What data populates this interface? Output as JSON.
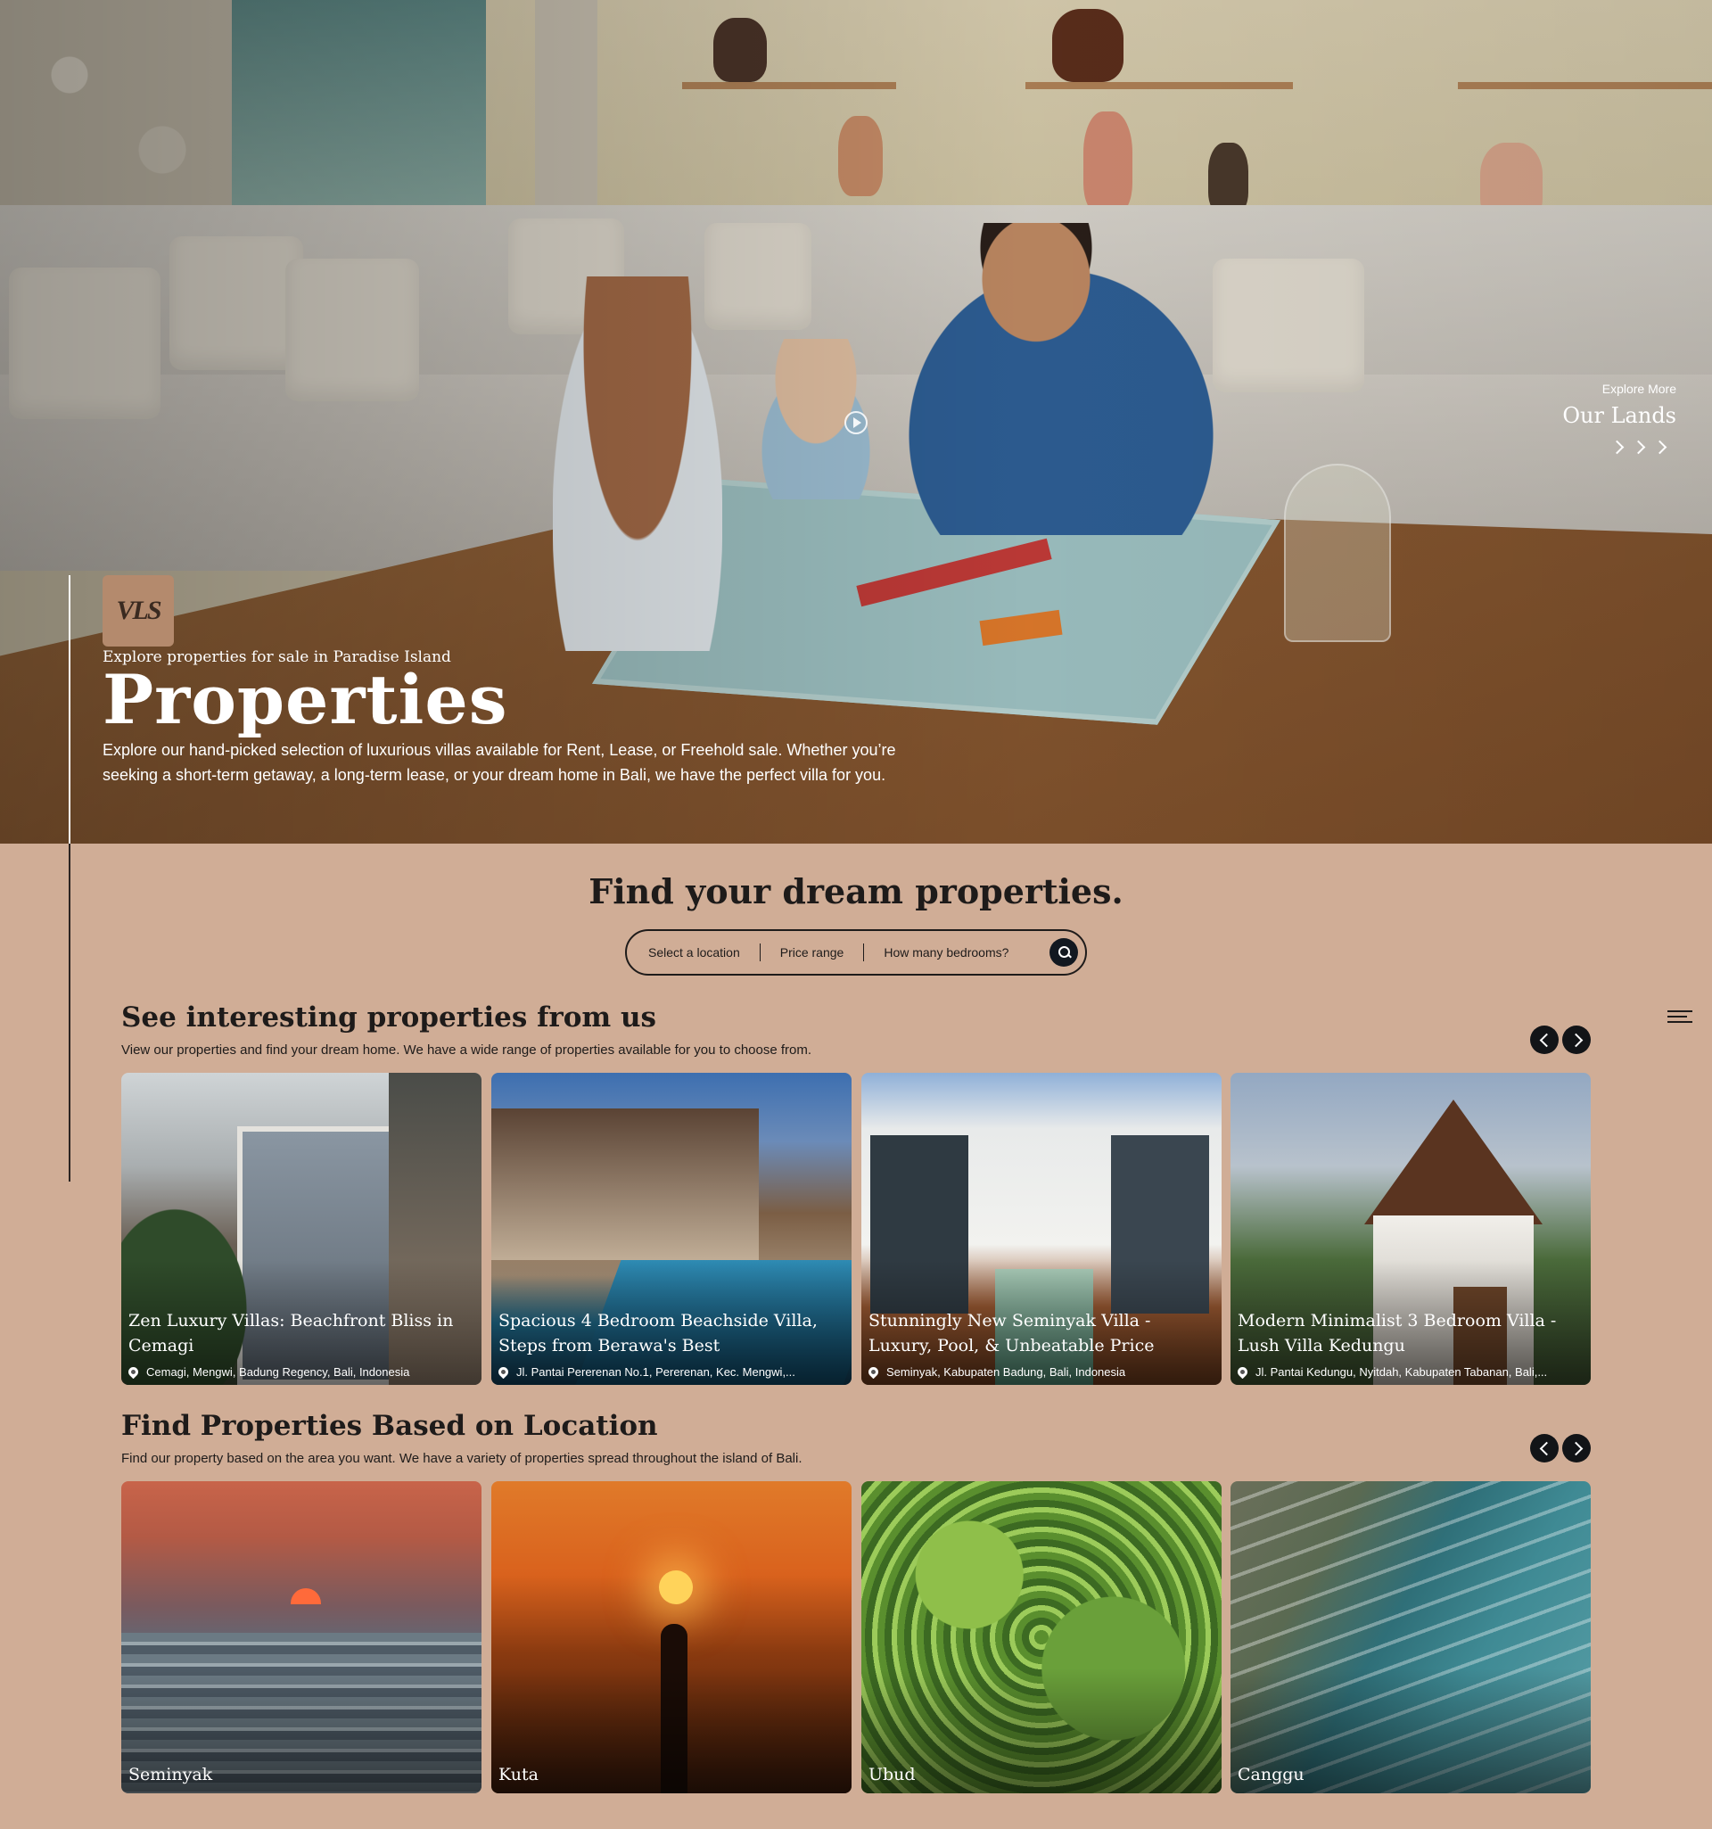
{
  "hero": {
    "logo_text": "VLS",
    "kicker": "Explore properties for sale in Paradise Island",
    "title": "Properties",
    "description": "Explore our hand-picked selection of luxurious villas available for Rent, Lease, or Freehold sale. Whether you’re seeking a short-term getaway, a long-term lease, or your dream home in Bali, we have the perfect villa for you.",
    "explore_small": "Explore More",
    "explore_big": "Our Lands"
  },
  "search": {
    "title": "Find your dream properties.",
    "location_label": "Select a location",
    "price_label": "Price range",
    "bedrooms_label": "How many bedrooms?"
  },
  "featured": {
    "title": "See interesting properties from us",
    "description": "View our properties and find your dream home. We have a wide range of properties available for you to choose from.",
    "cards": [
      {
        "title": "Zen Luxury Villas: Beachfront Bliss in Cemagi",
        "location": "Cemagi, Mengwi, Badung Regency, Bali, Indonesia"
      },
      {
        "title": "Spacious 4 Bedroom Beachside Villa, Steps from Berawa's Best",
        "location": "Jl. Pantai Pererenan No.1, Pererenan, Kec. Mengwi,..."
      },
      {
        "title": "Stunningly New Seminyak Villa - Luxury, Pool, & Unbeatable Price",
        "location": "Seminyak, Kabupaten Badung, Bali, Indonesia"
      },
      {
        "title": "Modern Minimalist 3 Bedroom Villa - Lush Villa Kedungu",
        "location": "Jl. Pantai Kedungu, Nyitdah, Kabupaten Tabanan, Bali,..."
      }
    ]
  },
  "locations": {
    "title": "Find Properties Based on Location",
    "description": "Find our property based on the area you want. We have a variety of properties spread throughout the island of Bali.",
    "cards": [
      {
        "name": "Seminyak"
      },
      {
        "name": "Kuta"
      },
      {
        "name": "Ubud"
      },
      {
        "name": "Canggu"
      }
    ]
  },
  "icons": {
    "play": "play-circle-icon",
    "search": "search-icon",
    "menu": "hamburger-menu-icon",
    "prev": "chevron-left-icon",
    "next": "chevron-right-icon",
    "pin": "map-pin-icon"
  },
  "colors": {
    "page_background": "#d0ad96",
    "button_dark": "#121417",
    "logo_background": "#b48a6d"
  }
}
